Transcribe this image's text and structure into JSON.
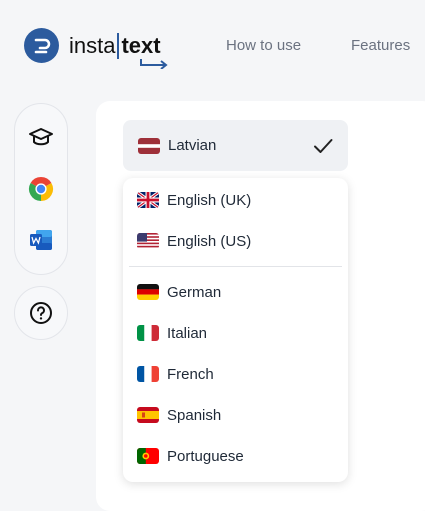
{
  "header": {
    "logo_word1": "insta",
    "logo_word2": "text",
    "nav": [
      "How to use",
      "Features"
    ]
  },
  "sidebar": {
    "items": [
      {
        "icon": "graduation-cap-icon"
      },
      {
        "icon": "chrome-icon"
      },
      {
        "icon": "word-icon"
      }
    ],
    "help_icon": "question-circle-icon"
  },
  "language_select": {
    "selected": "Latvian",
    "selected_flag": "latvia-flag-icon"
  },
  "languages": [
    {
      "label": "English (UK)",
      "flag": "uk-flag-icon"
    },
    {
      "label": "English (US)",
      "flag": "us-flag-icon"
    },
    {
      "label": "German",
      "flag": "germany-flag-icon"
    },
    {
      "label": "Italian",
      "flag": "italy-flag-icon"
    },
    {
      "label": "French",
      "flag": "france-flag-icon"
    },
    {
      "label": "Spanish",
      "flag": "spain-flag-icon"
    },
    {
      "label": "Portuguese",
      "flag": "portugal-flag-icon"
    }
  ],
  "colors": {
    "brand": "#2c5b9e",
    "latvia_red": "#9e3039"
  }
}
